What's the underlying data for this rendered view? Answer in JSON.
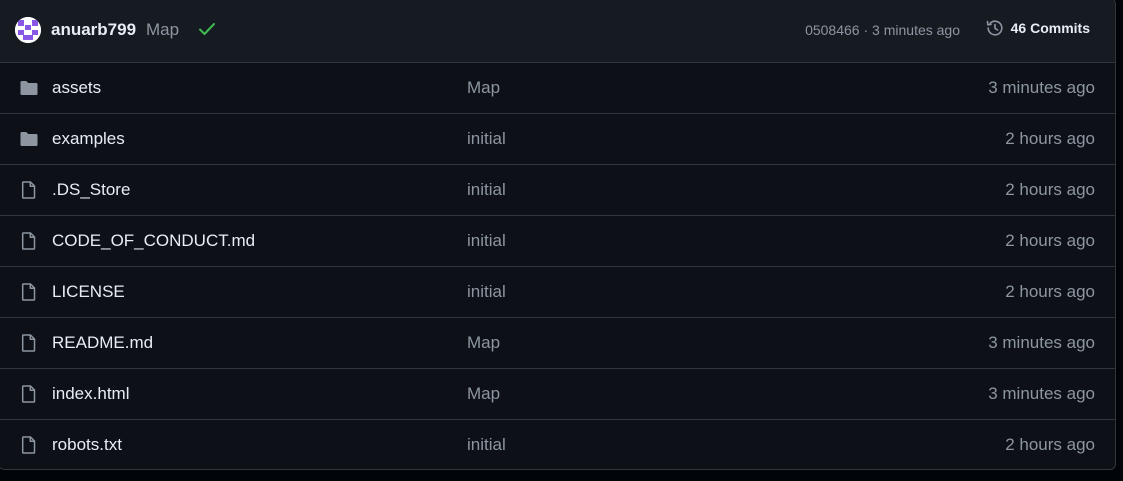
{
  "latest_commit": {
    "author": "anuarb799",
    "message": "Map",
    "status_icon": "check-icon",
    "sha": "0508466",
    "separator": " · ",
    "time": "3 minutes ago",
    "commits_label": "46 Commits"
  },
  "colors": {
    "folder": "#8d96a0",
    "file": "#8d96a0",
    "check": "#3fb950",
    "text_primary": "#e6edf3",
    "text_muted": "#8d96a0",
    "avatar": "#8957e5"
  },
  "files": [
    {
      "type": "folder",
      "icon": "folder-icon",
      "name": "assets",
      "message": "Map",
      "time": "3 minutes ago"
    },
    {
      "type": "folder",
      "icon": "folder-icon",
      "name": "examples",
      "message": "initial",
      "time": "2 hours ago"
    },
    {
      "type": "file",
      "icon": "file-icon",
      "name": ".DS_Store",
      "message": "initial",
      "time": "2 hours ago"
    },
    {
      "type": "file",
      "icon": "file-icon",
      "name": "CODE_OF_CONDUCT.md",
      "message": "initial",
      "time": "2 hours ago"
    },
    {
      "type": "file",
      "icon": "file-icon",
      "name": "LICENSE",
      "message": "initial",
      "time": "2 hours ago"
    },
    {
      "type": "file",
      "icon": "file-icon",
      "name": "README.md",
      "message": "Map",
      "time": "3 minutes ago"
    },
    {
      "type": "file",
      "icon": "file-icon",
      "name": "index.html",
      "message": "Map",
      "time": "3 minutes ago"
    },
    {
      "type": "file",
      "icon": "file-icon",
      "name": "robots.txt",
      "message": "initial",
      "time": "2 hours ago"
    }
  ]
}
